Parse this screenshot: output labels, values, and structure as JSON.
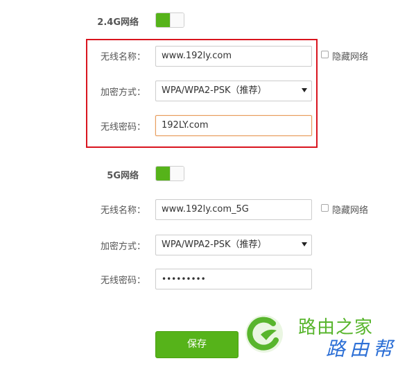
{
  "band_24g": {
    "title": "2.4G网络",
    "toggle_on": true,
    "ssid_label": "无线名称：",
    "ssid_value": "www.192ly.com",
    "hide_label": "隐藏网络",
    "encryption_label": "加密方式：",
    "encryption_value": "WPA/WPA2-PSK（推荐）",
    "password_label": "无线密码：",
    "password_value": "192LY.com"
  },
  "band_5g": {
    "title": "5G网络",
    "toggle_on": true,
    "ssid_label": "无线名称：",
    "ssid_value": "www.192ly.com_5G",
    "hide_label": "隐藏网络",
    "encryption_label": "加密方式：",
    "encryption_value": "WPA/WPA2-PSK（推荐）",
    "password_label": "无线密码：",
    "password_masked": "•••••••••"
  },
  "save_button": "保存",
  "watermark": {
    "text_green": "路由之家",
    "text_blue": "路由帮"
  },
  "colors": {
    "accent_green": "#56b31a",
    "highlight_red": "#d9141e",
    "focus_orange": "#e79b5a"
  }
}
